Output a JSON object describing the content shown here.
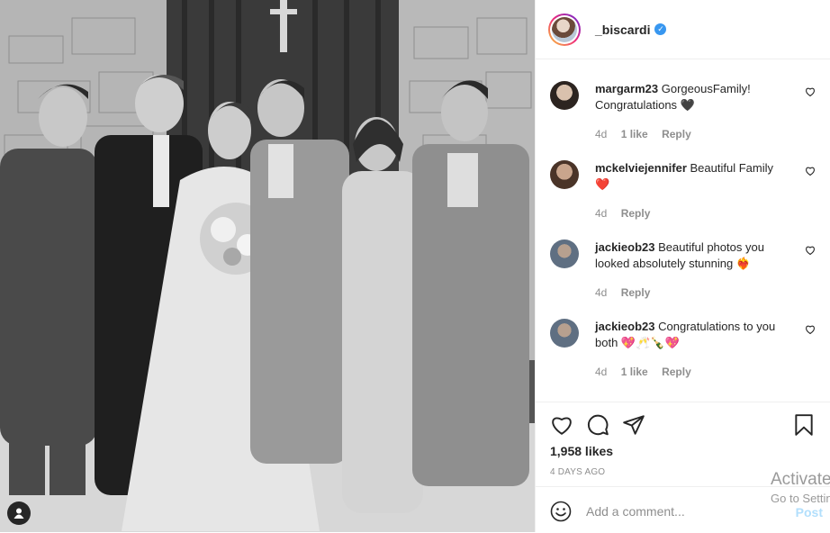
{
  "post": {
    "username": "_biscardi",
    "verified_icon": "verified-badge-icon",
    "likes": "1,958 likes",
    "time_ago": "4 DAYS AGO",
    "add_comment_placeholder": "Add a comment...",
    "post_label": "Post"
  },
  "comments": [
    {
      "user": "margarm23",
      "text": "GorgeousFamily! Congratulations 🖤",
      "time": "4d",
      "likes": "1 like",
      "reply": "Reply"
    },
    {
      "user": "mckelviejennifer",
      "text": "Beautiful Family ❤️",
      "time": "4d",
      "likes": "",
      "reply": "Reply"
    },
    {
      "user": "jackieob23",
      "text": "Beautiful photos you looked absolutely stunning ❤️‍🔥",
      "time": "4d",
      "likes": "",
      "reply": "Reply"
    },
    {
      "user": "jackieob23",
      "text": "Congratulations to you both 💖🥂🍾💖",
      "time": "4d",
      "likes": "1 like",
      "reply": "Reply"
    }
  ],
  "watermark": {
    "line1": "Activate Windows",
    "line2": "Go to Settings to activate Windows."
  },
  "colors": {
    "text": "#262626",
    "muted": "#8e8e8e",
    "verified": "#3897f0",
    "post_disabled": "#b2dffc"
  }
}
